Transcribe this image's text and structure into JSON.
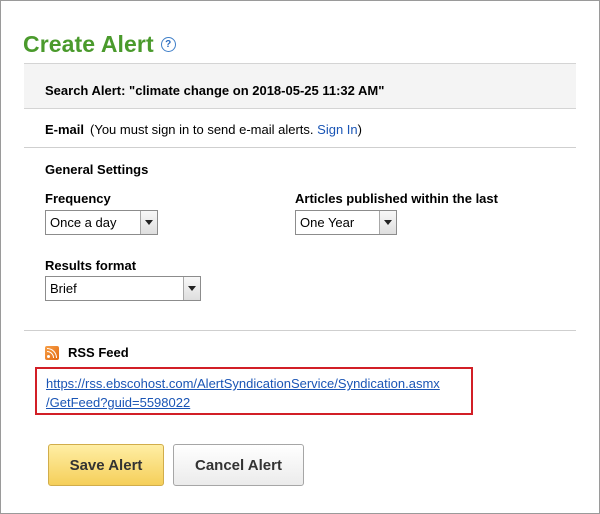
{
  "header": {
    "title": "Create Alert",
    "help_icon_glyph": "?"
  },
  "search_alert": {
    "text": "Search Alert: \"climate change on 2018-05-25 11:32 AM\""
  },
  "email": {
    "label": "E-mail",
    "note": "(You must sign in to send e-mail alerts.",
    "sign_in_link": "Sign In",
    "close_paren": ")"
  },
  "general_settings": {
    "heading": "General Settings",
    "frequency": {
      "label": "Frequency",
      "selected": "Once a day"
    },
    "published_within": {
      "label": "Articles published within the last",
      "selected": "One Year"
    },
    "results_format": {
      "label": "Results format",
      "selected": "Brief"
    }
  },
  "rss": {
    "label": "RSS Feed",
    "url_line1": "https://rss.ebscohost.com/AlertSyndicationService/Syndication.asmx",
    "url_line2": "/GetFeed?guid=5598022"
  },
  "buttons": {
    "save": "Save Alert",
    "cancel": "Cancel Alert"
  },
  "icons": {
    "help": "help-icon",
    "rss": "rss-feed-icon",
    "dropdown": "chevron-down-icon"
  },
  "colors": {
    "title_green": "#4a9a2c",
    "link_blue": "#1a55b5",
    "highlight_red": "#d21f26",
    "save_button_yellow": "#f5cf5a"
  }
}
